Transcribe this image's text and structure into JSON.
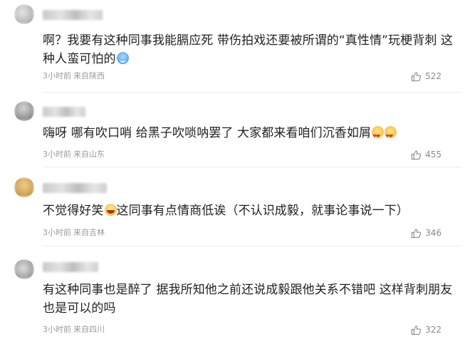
{
  "comments": [
    {
      "text_parts": [
        "啊？我要有这种同事我能膈应死 带伤拍戏还要被所谓的“真性情”玩梗背刺 这种人蛮可怕的"
      ],
      "emoji": "smile-emoji",
      "time": "3小时前",
      "location": "来自陕西",
      "likes": "522"
    },
    {
      "text_parts": [
        "嗨呀 哪有吹口哨 给黑子吹唢呐罢了 大家都来看咱们沉香如屑"
      ],
      "emoji": "heart-eyes-emoji",
      "time": "3小时前",
      "location": "来自山东",
      "likes": "455"
    },
    {
      "text_parts": [
        "不觉得好笑",
        "这同事有点情商低诶（不认识成毅，就事论事说一下）"
      ],
      "emoji": "laugh-emoji",
      "time": "3小时前",
      "location": "来自吉林",
      "likes": "346"
    },
    {
      "text_parts": [
        "有这种同事也是醉了 据我所知他之前还说成毅跟他关系不错吧 这样背刺朋友也是可以的吗"
      ],
      "emoji": "",
      "time": "3小时前",
      "location": "来自四川",
      "likes": "322"
    }
  ],
  "icons": {
    "like": "thumbs-up-icon"
  },
  "colors": {
    "text": "#222222",
    "meta": "#9a9a9a",
    "like": "#8a8a8a"
  }
}
